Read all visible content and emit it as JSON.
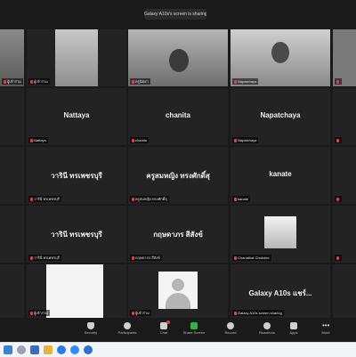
{
  "banner_text": "Galaxy A10s's screen is sharing",
  "tiles": [
    {
      "label": "ผู้เข้าร่วม",
      "name": ""
    },
    {
      "label": "ผู้เข้าร่วม",
      "name": ""
    },
    {
      "label": "ครูนิตยา",
      "name": ""
    },
    {
      "label": "Napatchaya",
      "name": ""
    },
    {
      "label": "",
      "name": ""
    },
    {
      "label": "Nattaya",
      "name": "Nattaya"
    },
    {
      "label": "chanita",
      "name": "chanita"
    },
    {
      "label": "Napatchaya",
      "name": "Napatchaya"
    },
    {
      "label": "",
      "name": ""
    },
    {
      "label": "วารินี ทรเพชรบุรี",
      "name": "วารินี ทรเพชรบุรี"
    },
    {
      "label": "ครูสมหญิง ทรงศักดิ์สุ",
      "name": "ครูสมหญิง ทรงศักดิ์สุ"
    },
    {
      "label": "kanate",
      "name": "kanate"
    },
    {
      "label": "",
      "name": ""
    },
    {
      "label": "วารินี ทรเพชรบุรี",
      "name": "วารินี ทรเพชรบุรี"
    },
    {
      "label": "กฤษดาภร สีสังข์",
      "name": "กฤษดาภร สีสังข์"
    },
    {
      "label": "Chanathat Chokdee",
      "name": ""
    },
    {
      "label": "",
      "name": ""
    },
    {
      "label": "ผู้เข้าร่วม",
      "name": ""
    },
    {
      "label": "ผู้เข้าร่วม",
      "name": ""
    },
    {
      "label": "Galaxy A10s screen sharing",
      "name": "Galaxy A10s แชร์..."
    }
  ],
  "toolbar": {
    "security": "Security",
    "participants": "Participants",
    "chat": "Chat",
    "share": "Share Screen",
    "record": "Record",
    "reactions": "Reactions",
    "apps": "Apps",
    "more": "More"
  },
  "colors": {
    "share_green": "#2fb344",
    "mic_red": "#e04040",
    "chat_badge": "#e04040"
  }
}
